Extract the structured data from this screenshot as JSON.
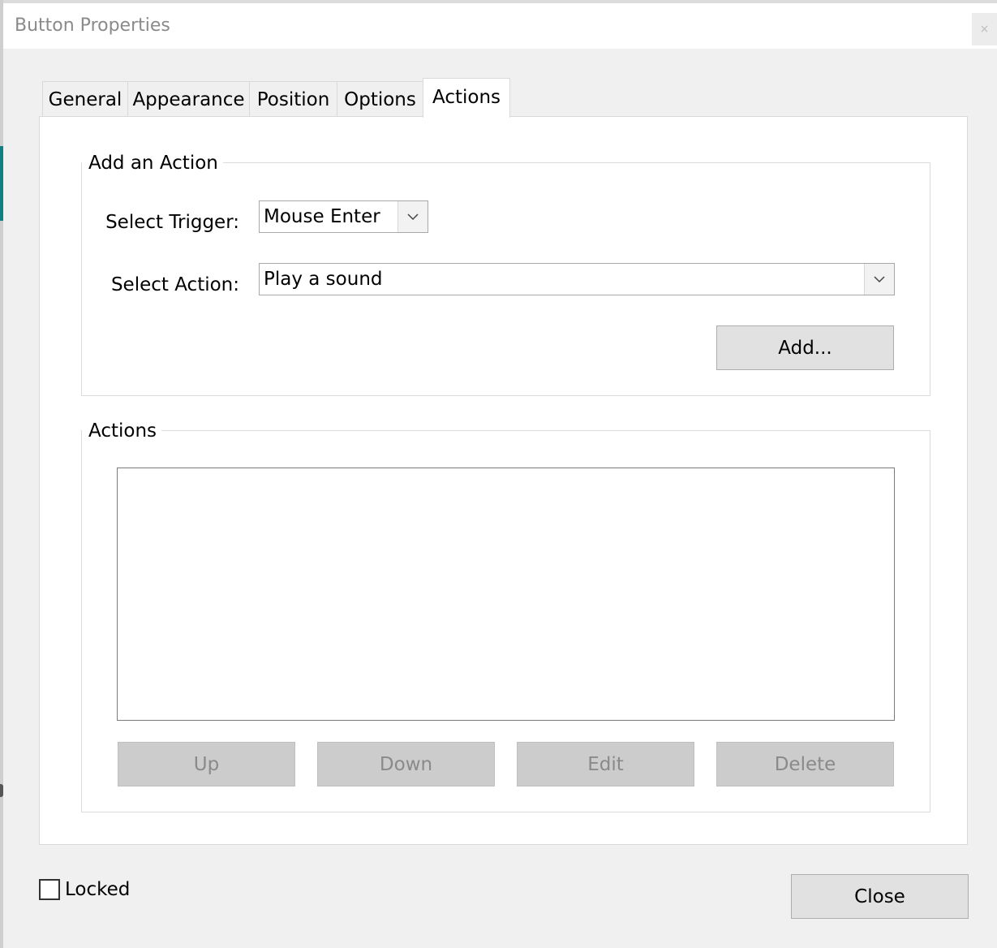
{
  "dialog": {
    "title": "Button Properties",
    "close_glyph": "×"
  },
  "tabs": [
    {
      "label": "General",
      "active": false
    },
    {
      "label": "Appearance",
      "active": false
    },
    {
      "label": "Position",
      "active": false
    },
    {
      "label": "Options",
      "active": false
    },
    {
      "label": "Actions",
      "active": true
    }
  ],
  "add_action": {
    "legend": "Add an Action",
    "trigger_label": "Select Trigger:",
    "trigger_value": "Mouse Enter",
    "action_label": "Select Action:",
    "action_value": "Play a sound",
    "add_button": "Add..."
  },
  "actions_group": {
    "legend": "Actions",
    "items": [],
    "buttons": {
      "up": "Up",
      "down": "Down",
      "edit": "Edit",
      "delete": "Delete"
    }
  },
  "footer": {
    "locked_label": "Locked",
    "locked_checked": false,
    "close_button": "Close"
  },
  "colors": {
    "dialog_bg": "#f0f0f0",
    "panel_bg": "#ffffff",
    "accent_edge": "#0f7f82",
    "disabled_button_bg": "#cccccc"
  },
  "icons": {
    "dropdown": "chevron-down-icon",
    "close": "close-icon"
  }
}
